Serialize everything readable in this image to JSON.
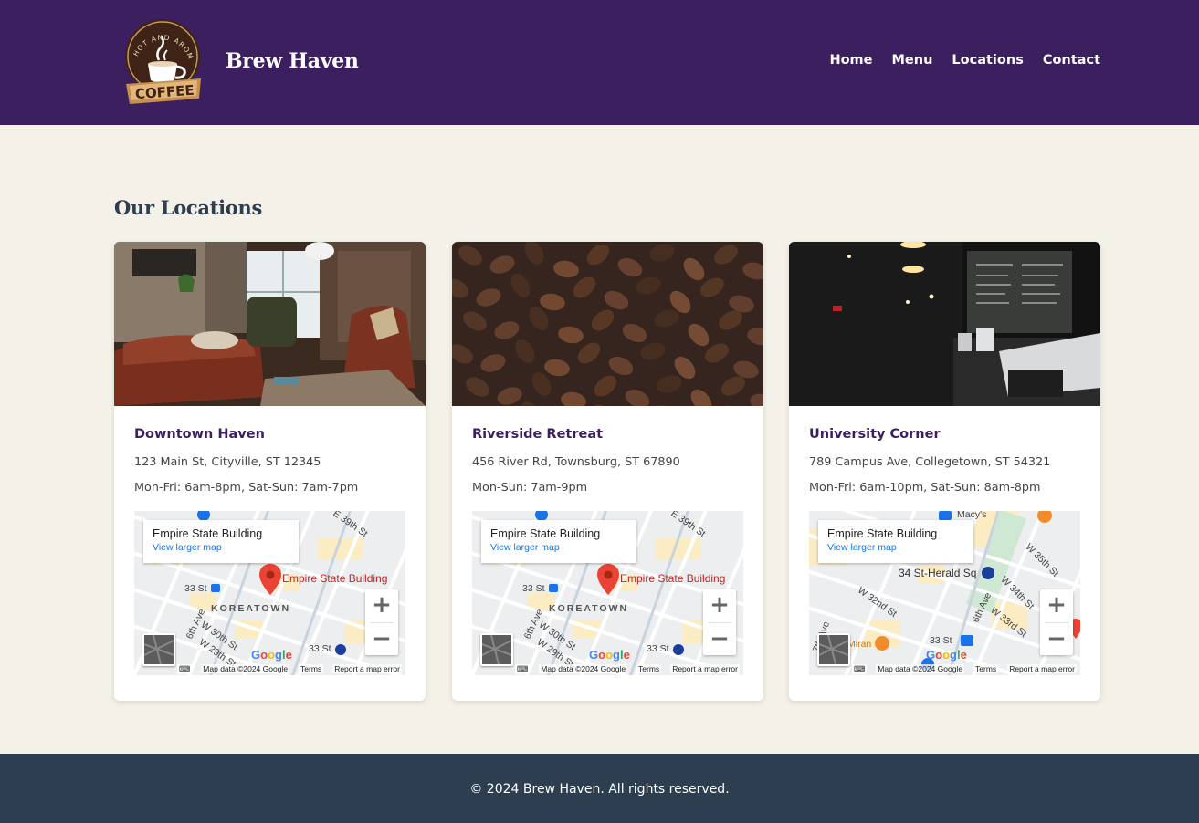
{
  "header": {
    "logo_text_top": "HOT AND AROMATIC",
    "logo_text_bottom": "COFFEE",
    "brand": "Brew Haven",
    "nav": [
      {
        "label": "Home"
      },
      {
        "label": "Menu"
      },
      {
        "label": "Locations"
      },
      {
        "label": "Contact"
      }
    ]
  },
  "main": {
    "title": "Our Locations",
    "locations": [
      {
        "name": "Downtown Haven",
        "address": "123 Main St, Cityville, ST 12345",
        "hours": "Mon-Fri: 6am-8pm, Sat-Sun: 7am-7pm",
        "photo_icon": "lounge-photo",
        "map": {
          "place": "Empire State Building",
          "link": "View larger map",
          "pin_label": "Empire State Building",
          "neighborhood": "KOREATOWN",
          "street_labels": [
            "33 St",
            "6th Ave",
            "W 30th St",
            "W 29th St",
            "E 39th St",
            "33 St"
          ]
        }
      },
      {
        "name": "Riverside Retreat",
        "address": "456 River Rd, Townsburg, ST 67890",
        "hours": "Mon-Sun: 7am-9pm",
        "photo_icon": "coffee-beans-photo",
        "map": {
          "place": "Empire State Building",
          "link": "View larger map",
          "pin_label": "Empire State Building",
          "neighborhood": "KOREATOWN",
          "street_labels": [
            "33 St",
            "6th Ave",
            "W 30th St",
            "W 29th St",
            "E 39th St",
            "33 St"
          ]
        }
      },
      {
        "name": "University Corner",
        "address": "789 Campus Ave, Collegetown, ST 54321",
        "hours": "Mon-Fri: 6am-10pm, Sat-Sun: 8am-8pm",
        "photo_icon": "cafe-interior-photo",
        "map": {
          "place": "Empire State Building",
          "link": "View larger map",
          "pin_label": "",
          "neighborhood": "34 St-Herald Sq",
          "street_labels": [
            "Macy's",
            "W 35th St",
            "W 34th St",
            "W 33rd St",
            "W 32nd St",
            "6th Ave",
            "7th Ave",
            "33 St",
            "Miran"
          ]
        }
      }
    ],
    "map_footer": {
      "data": "Map data ©2024 Google",
      "terms": "Terms",
      "report": "Report a map error",
      "google": "Google"
    }
  },
  "footer": {
    "copyright": "© 2024 Brew Haven. All rights reserved."
  },
  "colors": {
    "header_bg": "#3c1f5f",
    "page_bg": "#f4f1e8",
    "footer_bg": "#2c3e50",
    "accent": "#3c1f5f",
    "map_pin": "#ea4335"
  }
}
